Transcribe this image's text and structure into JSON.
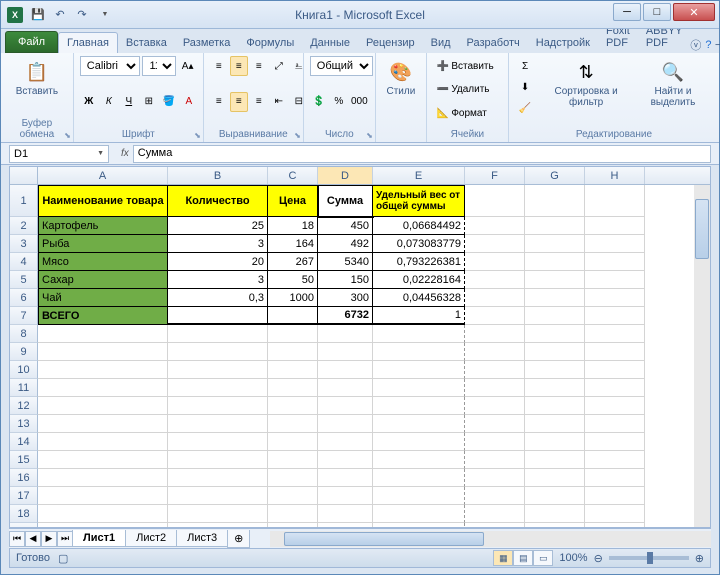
{
  "title": "Книга1 - Microsoft Excel",
  "tabs": {
    "file": "Файл",
    "items": [
      "Главная",
      "Вставка",
      "Разметка",
      "Формулы",
      "Данные",
      "Рецензир",
      "Вид",
      "Разработч",
      "Надстройк",
      "Foxit PDF",
      "ABBYY PDF"
    ],
    "active": 0
  },
  "ribbon": {
    "clipboard": {
      "paste": "Вставить",
      "label": "Буфер обмена"
    },
    "font": {
      "name": "Calibri",
      "size": "11",
      "label": "Шрифт"
    },
    "align": {
      "label": "Выравнивание"
    },
    "number": {
      "format": "Общий",
      "label": "Число"
    },
    "styles": {
      "btn": "Стили"
    },
    "cells": {
      "insert": "Вставить",
      "delete": "Удалить",
      "format": "Формат",
      "label": "Ячейки"
    },
    "editing": {
      "sort": "Сортировка и фильтр",
      "find": "Найти и выделить",
      "label": "Редактирование"
    }
  },
  "namebox": "D1",
  "formula": "Сумма",
  "columns": [
    "A",
    "B",
    "C",
    "D",
    "E",
    "F",
    "G",
    "H"
  ],
  "headers": {
    "name": "Наименование товара",
    "qty": "Количество",
    "price": "Цена",
    "sum": "Сумма",
    "weight": "Удельный вес от общей суммы"
  },
  "rows": [
    {
      "name": "Картофель",
      "qty": "25",
      "price": "18",
      "sum": "450",
      "w": "0,06684492"
    },
    {
      "name": "Рыба",
      "qty": "3",
      "price": "164",
      "sum": "492",
      "w": "0,073083779"
    },
    {
      "name": "Мясо",
      "qty": "20",
      "price": "267",
      "sum": "5340",
      "w": "0,793226381"
    },
    {
      "name": "Сахар",
      "qty": "3",
      "price": "50",
      "sum": "150",
      "w": "0,02228164"
    },
    {
      "name": "Чай",
      "qty": "0,3",
      "price": "1000",
      "sum": "300",
      "w": "0,04456328"
    }
  ],
  "total": {
    "label": "ВСЕГО",
    "sum": "6732",
    "w": "1"
  },
  "sheets": {
    "items": [
      "Лист1",
      "Лист2",
      "Лист3"
    ],
    "active": 0
  },
  "status": {
    "ready": "Готово",
    "zoom": "100%"
  }
}
